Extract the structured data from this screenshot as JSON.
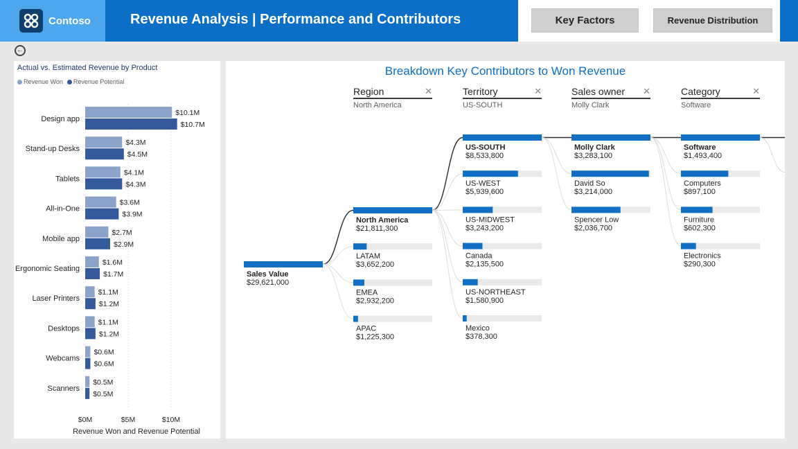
{
  "header": {
    "brand": "Contoso",
    "title": "Revenue Analysis | Performance and Contributors",
    "buttons": {
      "key_factors": "Key Factors",
      "revenue_distribution": "Revenue Distribution"
    },
    "colors": {
      "bar": "#0b6fc7",
      "logo_bg": "#4ea6ec"
    }
  },
  "left_chart": {
    "title": "Actual vs. Estimated Revenue by Product",
    "legend": [
      {
        "name": "Revenue Won",
        "color": "#8ba3c9"
      },
      {
        "name": "Revenue Potential",
        "color": "#345a9c"
      }
    ],
    "xlabel": "Revenue Won and Revenue Potential"
  },
  "chart_data": {
    "type": "bar",
    "orientation": "horizontal",
    "title": "Actual vs. Estimated Revenue by Product",
    "xlabel": "Revenue Won and Revenue Potential",
    "xlim": [
      0,
      12.5
    ],
    "xticks": [
      {
        "value": 0,
        "label": "$0M"
      },
      {
        "value": 5,
        "label": "$5M"
      },
      {
        "value": 10,
        "label": "$10M"
      }
    ],
    "categories": [
      "Design app",
      "Stand-up Desks",
      "Tablets",
      "All-in-One",
      "Mobile app",
      "Ergonomic Seating",
      "Laser Printers",
      "Desktops",
      "Webcams",
      "Scanners"
    ],
    "series": [
      {
        "name": "Revenue Won",
        "color": "#8ba3c9",
        "values": [
          10.1,
          4.3,
          4.1,
          3.6,
          2.7,
          1.6,
          1.1,
          1.1,
          0.6,
          0.5
        ],
        "labels": [
          "$10.1M",
          "$4.3M",
          "$4.1M",
          "$3.6M",
          "$2.7M",
          "$1.6M",
          "$1.1M",
          "$1.1M",
          "$0.6M",
          "$0.5M"
        ]
      },
      {
        "name": "Revenue Potential",
        "color": "#345a9c",
        "values": [
          10.7,
          4.5,
          4.3,
          3.9,
          2.9,
          1.7,
          1.2,
          1.2,
          0.6,
          0.5
        ],
        "labels": [
          "$10.7M",
          "$4.5M",
          "$4.3M",
          "$3.9M",
          "$2.9M",
          "$1.7M",
          "$1.2M",
          "$1.2M",
          "$0.6M",
          "$0.5M"
        ]
      }
    ]
  },
  "tree": {
    "title": "Breakdown Key Contributors to Won Revenue",
    "colors": {
      "bar": "#1170c4",
      "track": "#e9e9e9",
      "link": "#2b2b2b",
      "faint_link": "#dcdcdc"
    },
    "root": {
      "label": "Sales Value",
      "value": "$29,621,000"
    },
    "levels": [
      {
        "name": "Region",
        "selected": "North America",
        "items": [
          {
            "label": "North America",
            "value": "$21,811,300",
            "fill": 1.0,
            "selected": true
          },
          {
            "label": "LATAM",
            "value": "$3,652,200",
            "fill": 0.17
          },
          {
            "label": "EMEA",
            "value": "$2,932,200",
            "fill": 0.14
          },
          {
            "label": "APAC",
            "value": "$1,225,300",
            "fill": 0.06
          }
        ]
      },
      {
        "name": "Territory",
        "selected": "US-SOUTH",
        "items": [
          {
            "label": "US-SOUTH",
            "value": "$8,533,800",
            "fill": 1.0,
            "selected": true
          },
          {
            "label": "US-WEST",
            "value": "$5,939,600",
            "fill": 0.7
          },
          {
            "label": "US-MIDWEST",
            "value": "$3,243,200",
            "fill": 0.38
          },
          {
            "label": "Canada",
            "value": "$2,135,500",
            "fill": 0.25
          },
          {
            "label": "US-NORTHEAST",
            "value": "$1,580,900",
            "fill": 0.19
          },
          {
            "label": "Mexico",
            "value": "$378,300",
            "fill": 0.05
          }
        ]
      },
      {
        "name": "Sales owner",
        "selected": "Molly Clark",
        "items": [
          {
            "label": "Molly Clark",
            "value": "$3,283,100",
            "fill": 1.0,
            "selected": true
          },
          {
            "label": "David So",
            "value": "$3,214,000",
            "fill": 0.98
          },
          {
            "label": "Spencer Low",
            "value": "$2,036,700",
            "fill": 0.62
          }
        ]
      },
      {
        "name": "Category",
        "selected": "Software",
        "items": [
          {
            "label": "Software",
            "value": "$1,493,400",
            "fill": 1.0,
            "selected": true
          },
          {
            "label": "Computers",
            "value": "$897,100",
            "fill": 0.6
          },
          {
            "label": "Furniture",
            "value": "$602,300",
            "fill": 0.4
          },
          {
            "label": "Electronics",
            "value": "$290,300",
            "fill": 0.19
          }
        ]
      }
    ]
  }
}
